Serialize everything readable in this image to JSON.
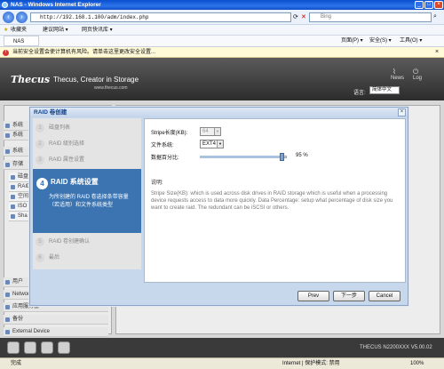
{
  "window": {
    "title": "NAS - Windows Internet Explorer"
  },
  "address": {
    "url": "http://192.168.1.100/adm/index.php",
    "search_placeholder": "Bing"
  },
  "favorites": {
    "label": "收藏夹",
    "items": [
      "建议网站 ▾",
      "网页快讯库 ▾"
    ]
  },
  "tab": {
    "label": "NAS",
    "tools": [
      "页面(P) ▾",
      "安全(S) ▾",
      "工具(O) ▾"
    ]
  },
  "security_bar": {
    "message": "当前安全设置会使计算机有风险。请单击这里更改安全设置..."
  },
  "header": {
    "logo": "Thecus",
    "tagline": "Thecus, Creator in Storage",
    "site": "www.thecus.com",
    "news": "News",
    "log": "Log",
    "lang_label": "语言:",
    "lang_value": "简体中文"
  },
  "sidebar": {
    "items": [
      {
        "label": "系统"
      },
      {
        "label": "系统"
      },
      {
        "label": "系统"
      },
      {
        "label": "存储"
      },
      {
        "label": "磁盘"
      },
      {
        "label": "RAID"
      },
      {
        "label": "空间"
      },
      {
        "label": "ISO"
      },
      {
        "label": "Sha"
      },
      {
        "label": "用户"
      },
      {
        "label": "Network Service"
      },
      {
        "label": "应用服务器"
      },
      {
        "label": "备份"
      },
      {
        "label": "External Device"
      }
    ]
  },
  "dialog": {
    "title": "RAID 卷创建",
    "close": "×",
    "steps": [
      {
        "num": "1",
        "label": "磁盘列表"
      },
      {
        "num": "2",
        "label": "RAID 级别选择"
      },
      {
        "num": "3",
        "label": "RAID 属性设置"
      },
      {
        "num": "4",
        "label": "RAID 系统设置",
        "desc": "为所创建的 RAID 卷选择条带容量（若适用）和文件系统类型"
      },
      {
        "num": "5",
        "label": "RAID 卷创建确认"
      },
      {
        "num": "6",
        "label": "最后"
      }
    ],
    "form": {
      "stripe_label": "Stripe长度(KB):",
      "stripe_value": "64",
      "fs_label": "文件系统:",
      "fs_value": "EXT4",
      "pct_label": "数据百分比:",
      "pct_value": 95,
      "pct_text": "95 %"
    },
    "desc_heading": "说明:",
    "desc_text": "Stripe Size(KB): which is used across disk drives in RAID storage which is useful when a processing device requests access to data more quickly. Data Percentage: setup what percentage of disk size you want to create raid. The redundant can be iSCSI or others.",
    "buttons": {
      "prev": "Prev",
      "next": "下一步",
      "cancel": "Cancel"
    }
  },
  "footer": {
    "version": "THECUS N2200XXX V5.00.02"
  },
  "ie_status": {
    "left": "完成",
    "zone": "Internet | 保护模式: 禁用",
    "zoom": "100%"
  }
}
